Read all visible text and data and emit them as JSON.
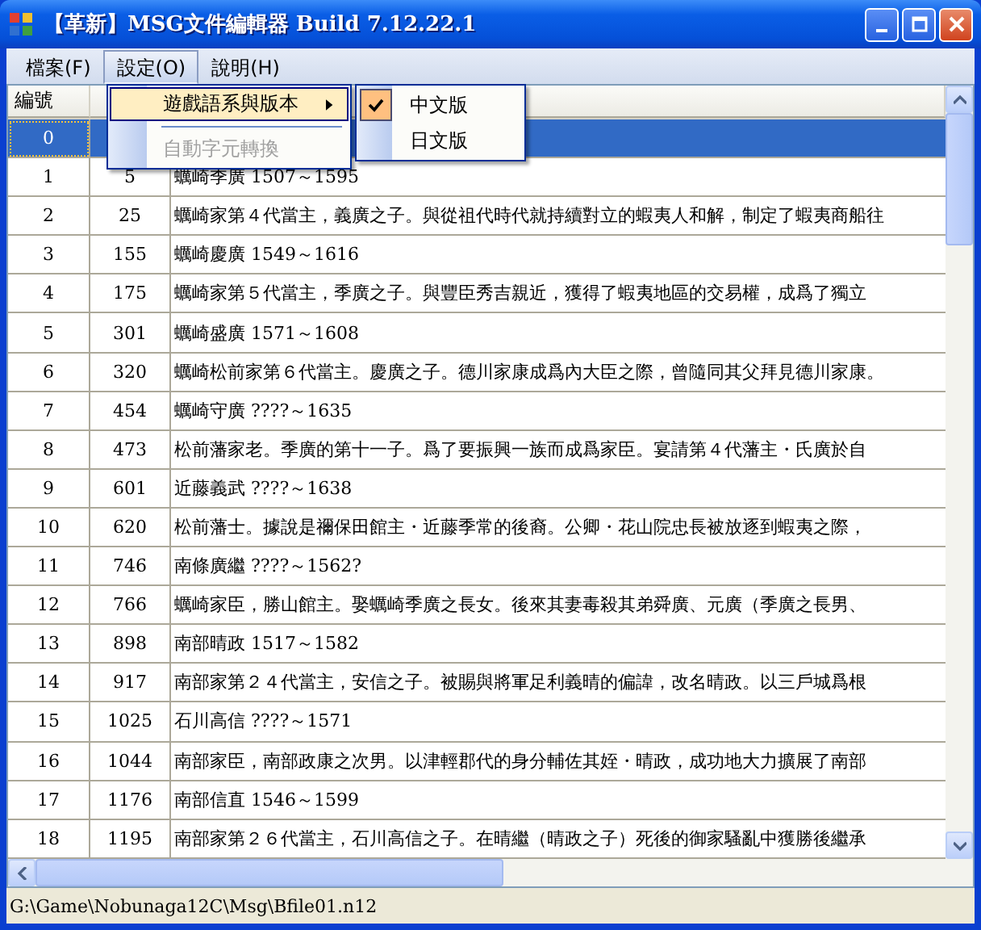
{
  "window": {
    "title": "【革新】MSG文件編輯器 Build 7.12.22.1"
  },
  "menu_bar": [
    {
      "label": "檔案(F)",
      "selected": false
    },
    {
      "label": "設定(O)",
      "selected": true
    },
    {
      "label": "說明(H)",
      "selected": false
    }
  ],
  "dropdown": [
    {
      "kind": "submenu",
      "label": "遊戲語系與版本",
      "selected": true,
      "disabled": false
    },
    {
      "kind": "separator"
    },
    {
      "kind": "item",
      "label": "自動字元轉換",
      "selected": false,
      "disabled": true
    }
  ],
  "submenu": [
    {
      "label": "中文版",
      "checked": true
    },
    {
      "label": "日文版",
      "checked": false
    }
  ],
  "table": {
    "columns": [
      "編號"
    ],
    "rows": [
      {
        "cells": [
          "0"
        ],
        "selected": true
      },
      {
        "cells": [
          "1",
          "5",
          "蠣崎季廣 1507～1595"
        ],
        "selected": false
      },
      {
        "cells": [
          "2",
          "25",
          "蠣崎家第４代當主，義廣之子。與從祖代時代就持續對立的蝦夷人和解，制定了蝦夷商船往"
        ],
        "selected": false
      },
      {
        "cells": [
          "3",
          "155",
          "蠣崎慶廣 1549～1616"
        ],
        "selected": false
      },
      {
        "cells": [
          "4",
          "175",
          "蠣崎家第５代當主，季廣之子。與豐臣秀吉親近，獲得了蝦夷地區的交易權，成爲了獨立"
        ],
        "selected": false
      },
      {
        "cells": [
          "5",
          "301",
          "蠣崎盛廣 1571～1608"
        ],
        "selected": false
      },
      {
        "cells": [
          "6",
          "320",
          "蠣崎松前家第６代當主。慶廣之子。德川家康成爲內大臣之際，曾隨同其父拜見德川家康。"
        ],
        "selected": false
      },
      {
        "cells": [
          "7",
          "454",
          "蠣崎守廣 ????～1635"
        ],
        "selected": false
      },
      {
        "cells": [
          "8",
          "473",
          "松前藩家老。季廣的第十一子。爲了要振興一族而成爲家臣。宴請第４代藩主・氏廣於自"
        ],
        "selected": false
      },
      {
        "cells": [
          "9",
          "601",
          "近藤義武 ????～1638"
        ],
        "selected": false
      },
      {
        "cells": [
          "10",
          "620",
          "松前藩士。據說是禰保田館主・近藤季常的後裔。公卿・花山院忠長被放逐到蝦夷之際，"
        ],
        "selected": false
      },
      {
        "cells": [
          "11",
          "746",
          "南條廣繼 ????～1562?"
        ],
        "selected": false
      },
      {
        "cells": [
          "12",
          "766",
          "蠣崎家臣，勝山館主。娶蠣崎季廣之長女。後來其妻毒殺其弟舜廣、元廣（季廣之長男、"
        ],
        "selected": false
      },
      {
        "cells": [
          "13",
          "898",
          "南部晴政 1517～1582"
        ],
        "selected": false
      },
      {
        "cells": [
          "14",
          "917",
          "南部家第２４代當主，安信之子。被賜與將軍足利義晴的偏諱，改名晴政。以三戶城爲根"
        ],
        "selected": false
      },
      {
        "cells": [
          "15",
          "1025",
          "石川高信 ????～1571"
        ],
        "selected": false
      },
      {
        "cells": [
          "16",
          "1044",
          "南部家臣，南部政康之次男。以津輕郡代的身分輔佐其姪・晴政，成功地大力擴展了南部"
        ],
        "selected": false
      },
      {
        "cells": [
          "17",
          "1176",
          "南部信直 1546～1599"
        ],
        "selected": false
      },
      {
        "cells": [
          "18",
          "1195",
          "南部家第２６代當主，石川高信之子。在晴繼（晴政之子）死後的御家騷亂中獲勝後繼承"
        ],
        "selected": false
      }
    ]
  },
  "status_bar": "G:\\Game\\Nobunaga12C\\Msg\\Bfile01.n12"
}
